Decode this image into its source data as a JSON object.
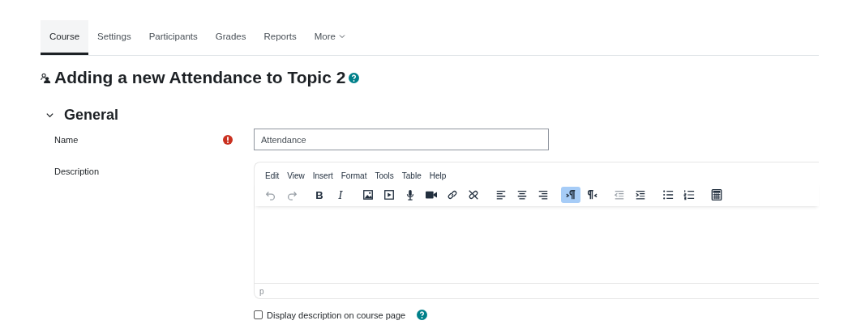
{
  "tabs": [
    {
      "label": "Course",
      "selected": true
    },
    {
      "label": "Settings",
      "selected": false
    },
    {
      "label": "Participants",
      "selected": false
    },
    {
      "label": "Grades",
      "selected": false
    },
    {
      "label": "Reports",
      "selected": false
    },
    {
      "label": "More",
      "selected": false,
      "dropdown": true
    }
  ],
  "heading": "Adding a new Attendance to Topic 2",
  "section": {
    "title": "General",
    "expanded": true
  },
  "name_field": {
    "label": "Name",
    "required": true,
    "value": "Attendance"
  },
  "description": {
    "label": "Description",
    "menubar": [
      "Edit",
      "View",
      "Insert",
      "Format",
      "Tools",
      "Table",
      "Help"
    ],
    "toolbar": [
      {
        "buttons": [
          {
            "kind": "undo",
            "disabled": true,
            "selected": false
          },
          {
            "kind": "redo",
            "disabled": true,
            "selected": false
          }
        ]
      },
      {
        "buttons": [
          {
            "kind": "bold",
            "label": "B",
            "disabled": false,
            "selected": false
          },
          {
            "kind": "italic",
            "label": "I",
            "disabled": false,
            "selected": false
          }
        ]
      },
      {
        "buttons": [
          {
            "kind": "image",
            "disabled": false,
            "selected": false
          },
          {
            "kind": "media",
            "disabled": false,
            "selected": false
          },
          {
            "kind": "microphone",
            "disabled": false,
            "selected": false
          },
          {
            "kind": "camera",
            "disabled": false,
            "selected": false
          },
          {
            "kind": "link",
            "disabled": false,
            "selected": false
          },
          {
            "kind": "unlink",
            "disabled": false,
            "selected": false
          }
        ]
      },
      {
        "buttons": [
          {
            "kind": "align-left",
            "disabled": false,
            "selected": false
          },
          {
            "kind": "align-center",
            "disabled": false,
            "selected": false
          },
          {
            "kind": "align-right",
            "disabled": false,
            "selected": false
          }
        ]
      },
      {
        "buttons": [
          {
            "kind": "ltr",
            "disabled": false,
            "selected": true
          },
          {
            "kind": "rtl",
            "disabled": false,
            "selected": false
          }
        ]
      },
      {
        "buttons": [
          {
            "kind": "outdent",
            "disabled": true,
            "selected": false
          },
          {
            "kind": "indent",
            "disabled": false,
            "selected": false
          }
        ]
      },
      {
        "buttons": [
          {
            "kind": "bullets",
            "disabled": false,
            "selected": false
          },
          {
            "kind": "numbers",
            "disabled": false,
            "selected": false
          }
        ]
      },
      {
        "buttons": [
          {
            "kind": "calculator",
            "disabled": false,
            "selected": false
          }
        ]
      }
    ],
    "status_path": "p"
  },
  "display_checkbox": {
    "label": "Display description on course page",
    "checked": false
  }
}
